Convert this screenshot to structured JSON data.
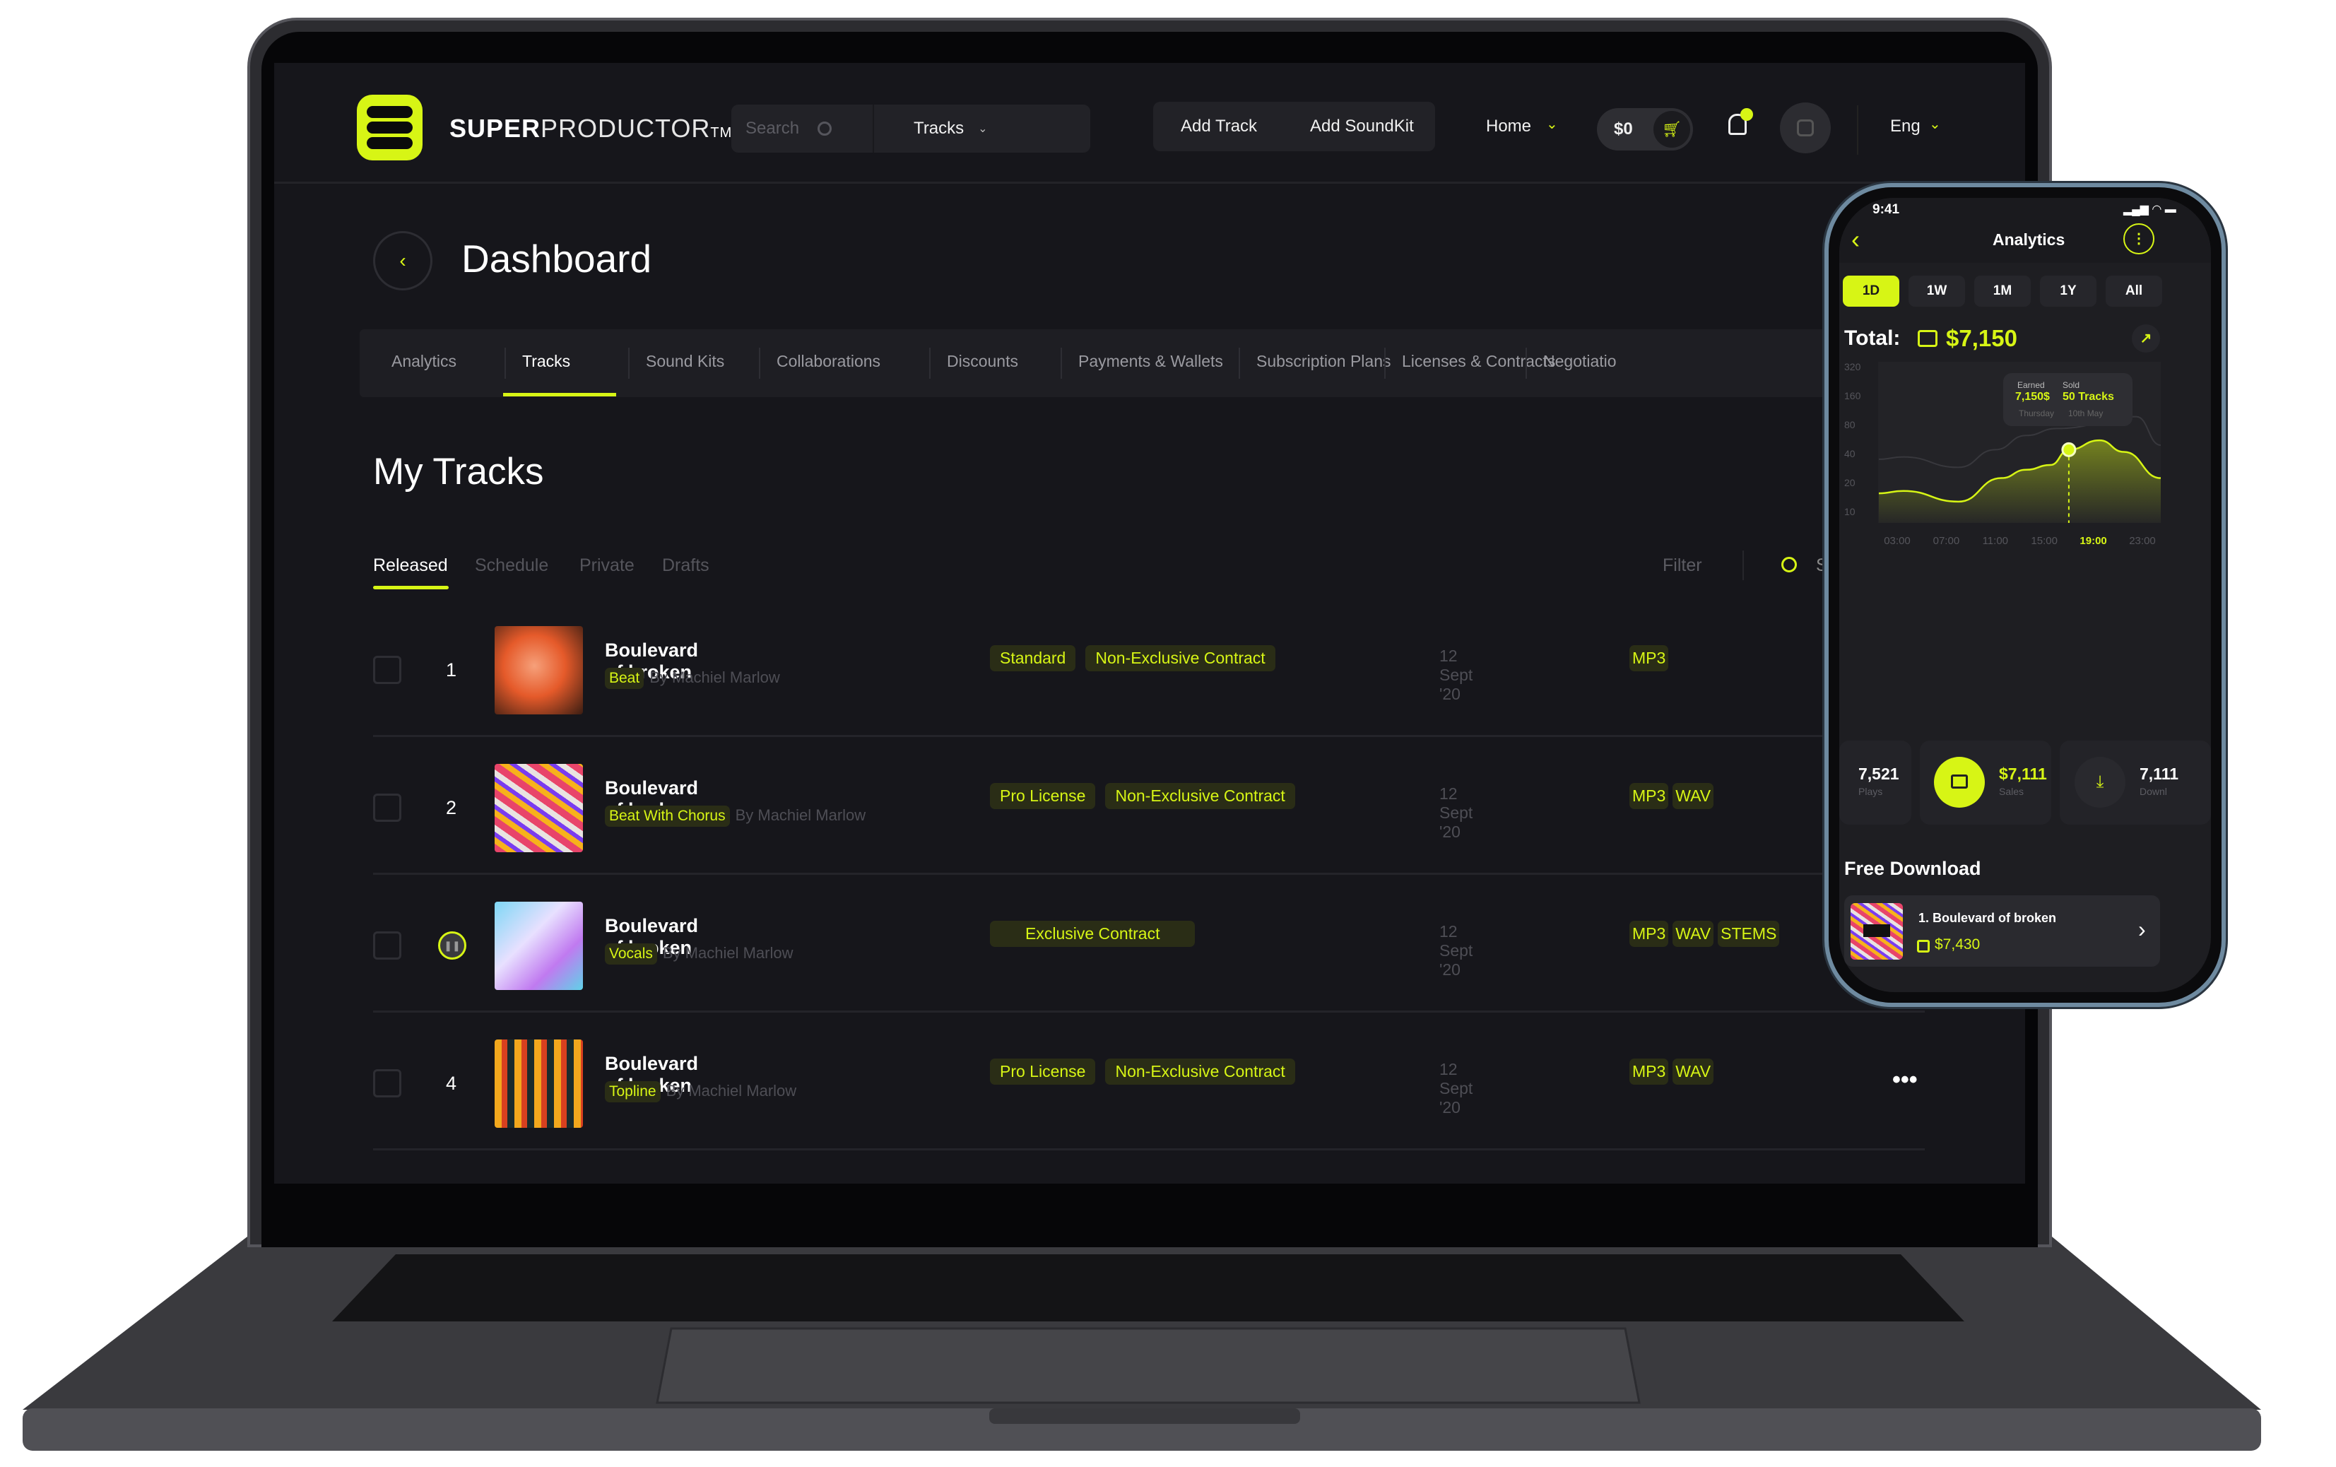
{
  "brand": {
    "name_bold": "SUPER",
    "name_light": "PRODUCTOR",
    "tm": "TM"
  },
  "header": {
    "search_placeholder": "Search",
    "category": "Tracks",
    "add_track": "Add Track",
    "add_soundkit": "Add SoundKit",
    "home": "Home",
    "cart_amount": "$0",
    "language": "Eng"
  },
  "page": {
    "title": "Dashboard",
    "section_title": "My Tracks"
  },
  "tabs": [
    "Analytics",
    "Tracks",
    "Sound Kits",
    "Collaborations",
    "Discounts",
    "Payments & Wallets",
    "Subscription Plans",
    "Licenses & Contracts",
    "Negotiatio"
  ],
  "active_tab": "Tracks",
  "subtabs": [
    "Released",
    "Schedule",
    "Private",
    "Drafts"
  ],
  "filter_label": "Filter",
  "search_partial": "S",
  "tracks": [
    {
      "number": "1",
      "title": "Boulevard of broken",
      "type": "Beat",
      "author": "By Machiel Marlow",
      "licenses": [
        "Standard",
        "Non-Exclusive Contract"
      ],
      "date": "12 Sept '20",
      "formats": [
        "MP3"
      ]
    },
    {
      "number": "2",
      "title": "Boulevard of broken",
      "type": "Beat With Chorus",
      "author": "By Machiel Marlow",
      "licenses": [
        "Pro License",
        "Non-Exclusive Contract"
      ],
      "date": "12 Sept '20",
      "formats": [
        "MP3",
        "WAV"
      ]
    },
    {
      "number": "",
      "playing": true,
      "title": "Boulevard of broken",
      "type": "Vocals",
      "author": "By Machiel Marlow",
      "licenses": [
        "Exclusive Contract"
      ],
      "date": "12 Sept '20",
      "formats": [
        "MP3",
        "WAV",
        "STEMS"
      ]
    },
    {
      "number": "4",
      "title": "Boulevard of broken",
      "type": "Topline",
      "author": "By Machiel Marlow",
      "licenses": [
        "Pro License",
        "Non-Exclusive Contract"
      ],
      "date": "12 Sept '20",
      "formats": [
        "MP3",
        "WAV"
      ]
    }
  ],
  "accent_color": "#d7f515",
  "phone": {
    "time": "9:41",
    "title": "Analytics",
    "periods": [
      "1D",
      "1W",
      "1M",
      "1Y",
      "All"
    ],
    "active_period": "1D",
    "total_label": "Total:",
    "total_value": "$7,150",
    "tooltip": {
      "earned_label": "Earned",
      "earned_value": "7,150$",
      "sold_label": "Sold",
      "sold_value": "50 Tracks",
      "day": "Thursday",
      "date": "10th May"
    },
    "stats": [
      {
        "value": "7,521",
        "label": "Plays"
      },
      {
        "value": "$7,111",
        "label": "Sales"
      },
      {
        "value": "7,111",
        "label": "Downl"
      }
    ],
    "free_download_title": "Free Download",
    "free_item": {
      "title": "1. Boulevard of broken",
      "price": "$7,430"
    }
  },
  "chart_data": {
    "type": "area",
    "y_scale": "log2",
    "y_ticks": [
      320,
      160,
      80,
      40,
      20,
      10
    ],
    "x_ticks": [
      "03:00",
      "07:00",
      "11:00",
      "15:00",
      "19:00",
      "23:00"
    ],
    "highlighted_x_tick": "19:00",
    "ylim": [
      10,
      320
    ],
    "grid": false,
    "series": [
      {
        "role": "primary",
        "x": [
          "01:30",
          "03:30",
          "08:00",
          "11:30",
          "13:30",
          "15:30",
          "17:00",
          "19:30",
          "21:30",
          "24:30"
        ],
        "y": [
          15.5,
          16.4,
          12.7,
          22.3,
          27.2,
          30.5,
          44,
          55,
          41.7,
          22.3
        ],
        "highlight_index": 6
      },
      {
        "role": "comparison",
        "x": [
          "01:30",
          "03:30",
          "08:00",
          "11:00",
          "13:30",
          "16:00",
          "22:30",
          "24:30"
        ],
        "y": [
          35,
          37,
          28.8,
          44,
          61.8,
          73,
          97,
          49
        ]
      }
    ]
  }
}
